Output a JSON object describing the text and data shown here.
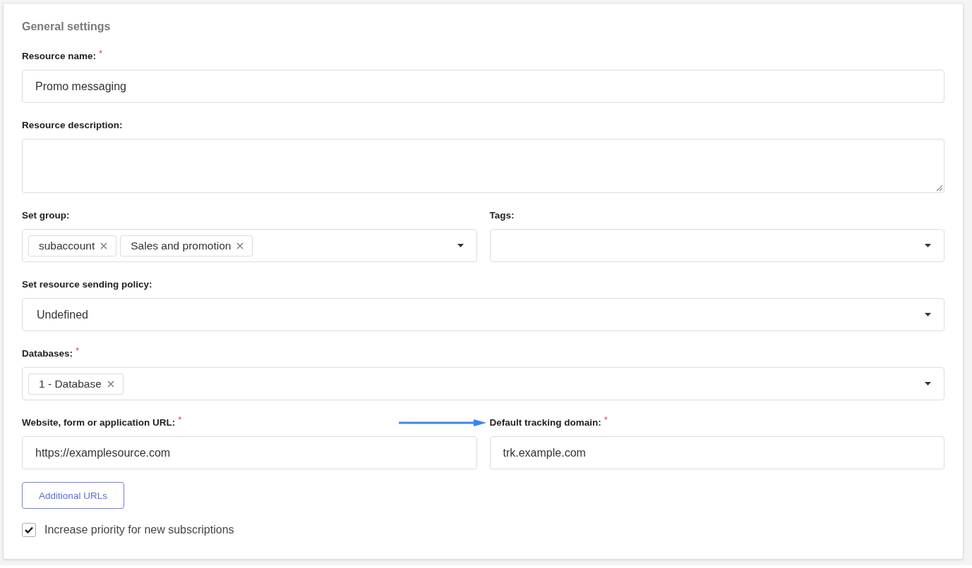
{
  "section_title": "General settings",
  "rows": [
    [
      {
        "kind": "text",
        "label": "Resource name:",
        "required_mark": "*",
        "value": "Promo messaging"
      }
    ],
    [
      {
        "kind": "textarea",
        "label": "Resource description:"
      }
    ],
    [
      {
        "kind": "multiselect",
        "label": "Set group:",
        "tags": [
          "subaccount",
          "Sales and promotion"
        ]
      },
      {
        "kind": "multiselect",
        "label": "Tags:"
      }
    ],
    [
      {
        "kind": "select",
        "label": "Set resource sending policy:",
        "value": "Undefined"
      }
    ],
    [
      {
        "kind": "multiselect",
        "label": "Databases:",
        "required_mark": "*",
        "tags": [
          "1 - Database"
        ]
      }
    ],
    [
      {
        "kind": "text",
        "label": "Website, form or application URL:",
        "required_mark": "*",
        "value": "https://examplesource.com"
      },
      {
        "kind": "text",
        "label": "Default tracking domain:",
        "required_mark": "*",
        "value": "trk.example.com",
        "pointer_arrow": true
      }
    ]
  ],
  "additional_button": "Additional URLs",
  "priority_checkbox": {
    "label": "Increase priority for new subscriptions",
    "checked": true
  }
}
